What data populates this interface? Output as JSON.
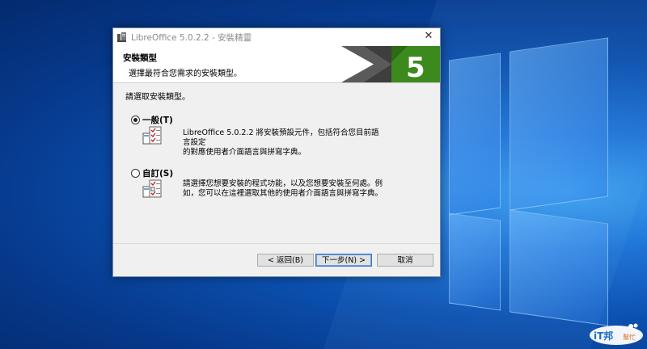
{
  "window": {
    "title": "LibreOffice 5.0.2.2 - 安裝精靈"
  },
  "header": {
    "title": "安裝類型",
    "subtitle": "選擇最符合您需求的安裝類型。",
    "banner_number": "5",
    "banner_color": "#3c8a1e"
  },
  "body": {
    "prompt": "請選取安裝類型。",
    "options": [
      {
        "label": "一般(T)",
        "checked": true,
        "description_line1": "LibreOffice 5.0.2.2 將安裝預設元件，包括符合您目前語言設定",
        "description_line2": "的對應使用者介面語言與拼寫字典。"
      },
      {
        "label": "自訂(S)",
        "checked": false,
        "description_line1": "請選擇您想要安裝的程式功能，以及您想要安裝至何處。例",
        "description_line2": "如，您可以在這裡選取其他的使用者介面語言與拼寫字典。"
      }
    ]
  },
  "buttons": {
    "back": "< 返回(B)",
    "next": "下一步(N) >",
    "cancel": "取消"
  },
  "watermark": {
    "text1": "iT邦",
    "text2": "幫忙"
  }
}
